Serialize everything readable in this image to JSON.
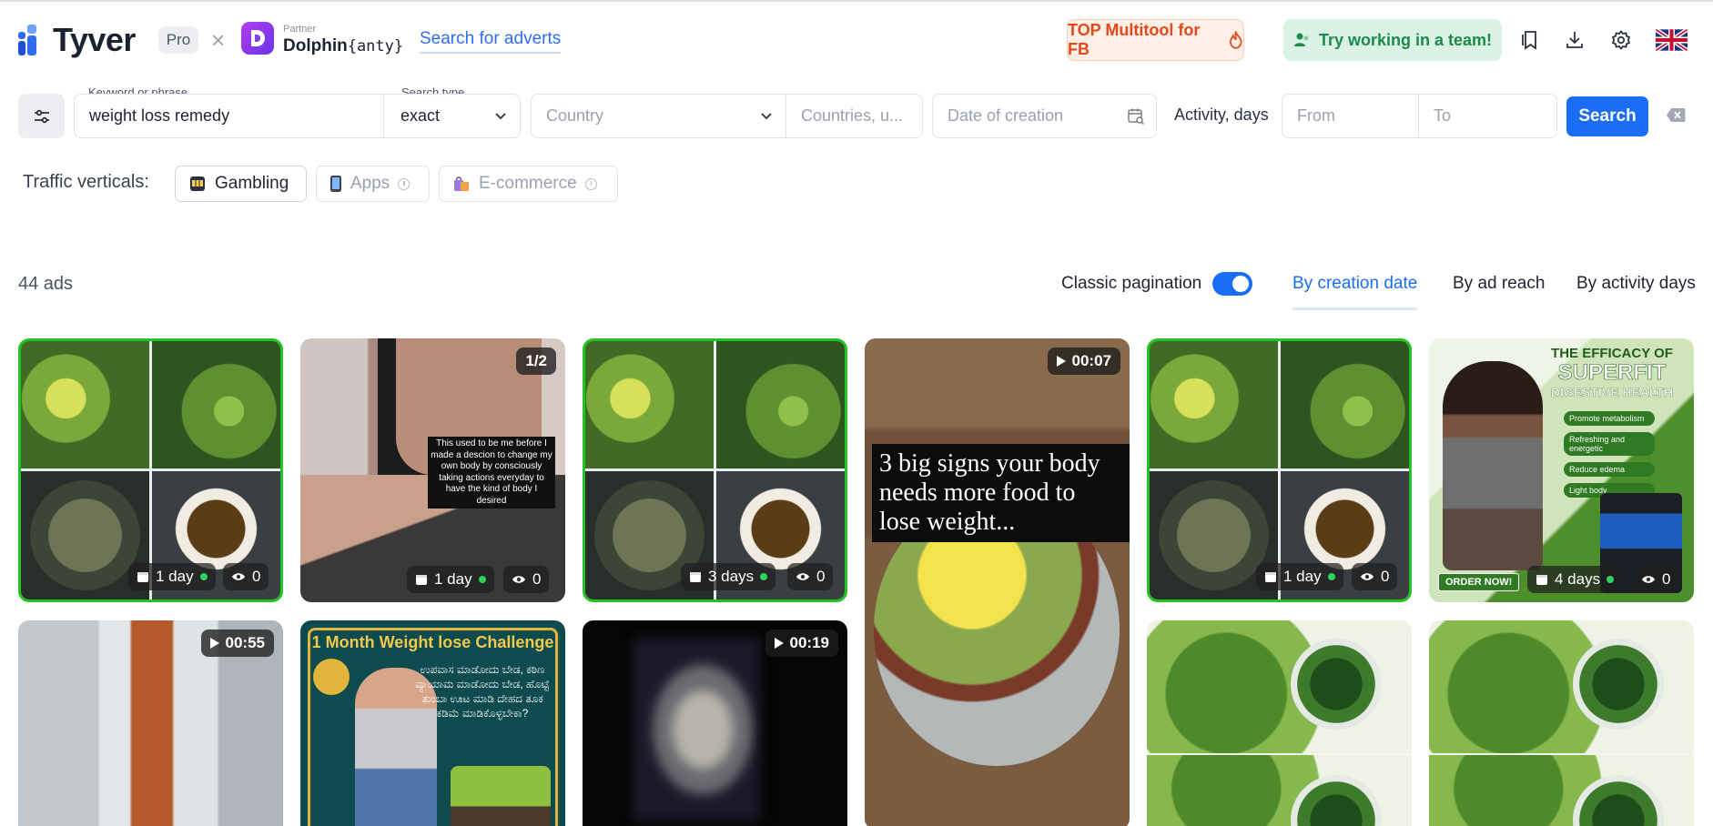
{
  "header": {
    "logo_text": "Tyver",
    "plan_badge": "Pro",
    "times_symbol": "×",
    "partner_label": "Partner",
    "partner_name_bold": "Dolphin",
    "partner_name_suffix": "{anty}",
    "search_adverts": "Search for adverts",
    "top_multitool": "TOP Multitool for FB",
    "team_button": "Try working in a team!",
    "language": "English (UK)"
  },
  "filters": {
    "keyword_label": "Keyword or phrase",
    "keyword_value": "weight loss remedy",
    "search_type_label": "Search type",
    "search_type_value": "exact",
    "country_placeholder": "Country",
    "countries_placeholder": "Countries, u...",
    "date_placeholder": "Date of creation",
    "activity_label": "Activity, days",
    "from_placeholder": "From",
    "to_placeholder": "To",
    "search_button": "Search"
  },
  "verticals": {
    "label": "Traffic verticals:",
    "items": [
      {
        "label": "Gambling",
        "enabled": true
      },
      {
        "label": "Apps",
        "enabled": false
      },
      {
        "label": "E-commerce",
        "enabled": false
      }
    ]
  },
  "results": {
    "count": "44 ads",
    "pagination_label": "Classic pagination",
    "pagination_on": true,
    "sort_options": [
      "By creation date",
      "By ad reach",
      "By activity days"
    ],
    "active_sort": "By creation date"
  },
  "cards": [
    {
      "days": "1 day",
      "views": "0",
      "kind": "herb-grid"
    },
    {
      "days": "1 day",
      "views": "0",
      "badge": "1/2",
      "text": "This used to be me before I made a descion to change my own body by consciously taking actions everyday to have the kind of body I desired"
    },
    {
      "days": "3 days",
      "views": "0",
      "kind": "herb-grid"
    },
    {
      "badge": "00:07",
      "text": "3 big signs your body needs more food to lose weight..."
    },
    {
      "days": "1 day",
      "views": "0",
      "kind": "herb-grid"
    },
    {
      "days": "4 days",
      "views": "0",
      "title": "THE EFFICACY OF",
      "brand": "SUPERFIT",
      "subtitle": "DIGESTIVE HEALTH",
      "benefits": [
        "Promote metabolism",
        "Refreshing and energetic",
        "Reduce edema",
        "Light body"
      ],
      "cta": "ORDER NOW!"
    },
    {
      "badge": "00:55"
    },
    {
      "title": "1 Month Weight lose Challenge",
      "text": "ಉಪವಾಸ ಮಾಡೋದು ಬೇಡ, ಕಠಿಣ ವ್ಯಾಯಾಮ ಮಾಡೋದು ಬೇಡ, ಹೊಟ್ಟೆ ತುಂಬಾ ಊಟ ಮಾಡಿ ದೇಹದ ತೂಕ ಕಡಿಮೆ ಮಾಡಿಕೊಳ್ಳಬೇಕಾ?"
    },
    {
      "badge": "00:19"
    },
    {
      "kind": "papaya"
    },
    {
      "kind": "papaya"
    }
  ],
  "colors": {
    "accent": "#1a6ef5",
    "green_border": "#22c322",
    "multitool_text": "#e2481a",
    "team_text": "#1f8a4c"
  }
}
